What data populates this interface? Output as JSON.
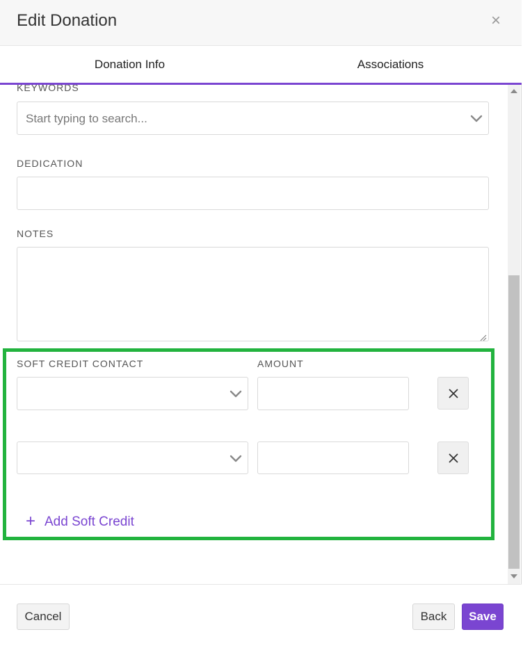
{
  "colors": {
    "accent": "#7a45d1",
    "highlight": "#22b33e"
  },
  "header": {
    "title": "Edit Donation",
    "close_icon": "close-icon"
  },
  "tabs": [
    {
      "label": "Donation Info"
    },
    {
      "label": "Associations"
    }
  ],
  "form": {
    "keywords": {
      "label": "KEYWORDS",
      "placeholder": "Start typing to search...",
      "value": ""
    },
    "dedication": {
      "label": "DEDICATION",
      "value": ""
    },
    "notes": {
      "label": "NOTES",
      "value": ""
    },
    "soft_credits": {
      "contact_label": "SOFT CREDIT CONTACT",
      "amount_label": "AMOUNT",
      "rows": [
        {
          "contact": "",
          "amount": ""
        },
        {
          "contact": "",
          "amount": ""
        }
      ],
      "add_label": "Add Soft Credit"
    }
  },
  "footer": {
    "cancel": "Cancel",
    "back": "Back",
    "save": "Save"
  }
}
